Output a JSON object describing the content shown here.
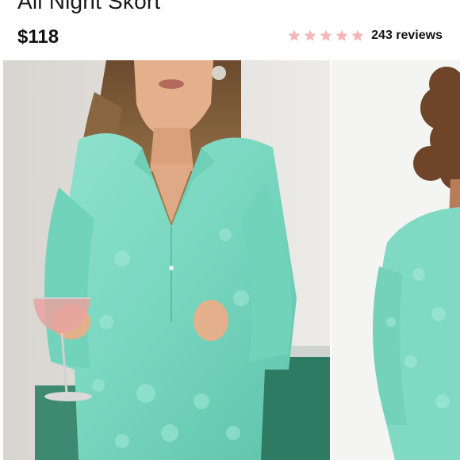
{
  "product": {
    "title": "All Night Skort",
    "price": "$118",
    "rating": {
      "value": 5,
      "max": 5,
      "reviews_label": "243 reviews"
    }
  },
  "colors": {
    "star": "#f6b6b9",
    "shirt": "#7fd9c3",
    "background": "#ffffff"
  },
  "gallery": {
    "images": [
      {
        "name": "model-photo-front",
        "icon": "photo"
      },
      {
        "name": "model-photo-side",
        "icon": "photo"
      }
    ]
  }
}
